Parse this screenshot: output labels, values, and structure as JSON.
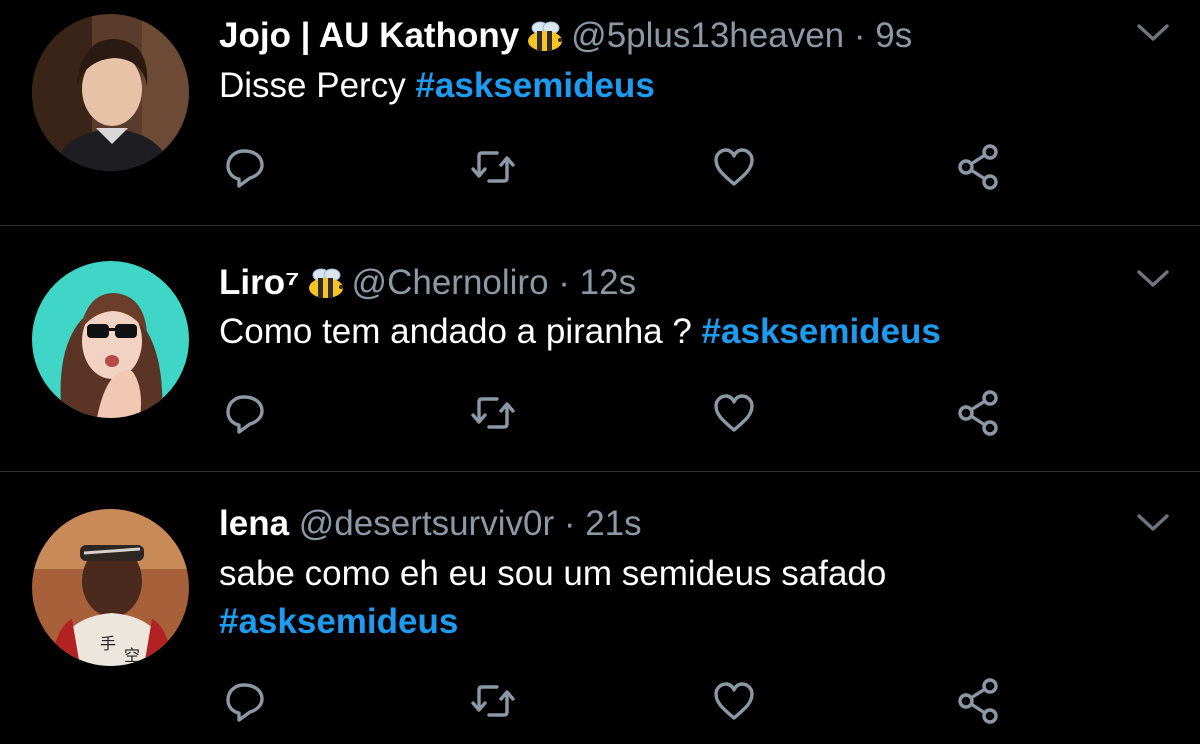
{
  "colors": {
    "background": "#000000",
    "hashtag": "#1d9bf0",
    "muted": "#8b98a5",
    "divider": "#2f3336"
  },
  "tweets": [
    {
      "name": "Jojo | AU Kathony",
      "name_badge": "bee-emoji",
      "handle": "@5plus13heaven",
      "separator": "·",
      "time": "9s",
      "text": "Disse Percy",
      "hashtag": "#asksemideus"
    },
    {
      "name": "Liro⁷",
      "name_badge": "bee-emoji",
      "handle": "@Chernoliro",
      "separator": "·",
      "time": "12s",
      "text": "Como tem andado a piranha ?",
      "hashtag": "#asksemideus"
    },
    {
      "name": "lena",
      "handle": "@desertsurviv0r",
      "separator": "·",
      "time": "21s",
      "text": "sabe como eh eu sou um semideus safado",
      "hashtag": "#asksemideus"
    }
  ],
  "icons": {
    "reply": "reply-icon",
    "retweet": "retweet-icon",
    "like": "heart-icon",
    "share": "share-icon",
    "menu": "chevron-down-icon"
  }
}
